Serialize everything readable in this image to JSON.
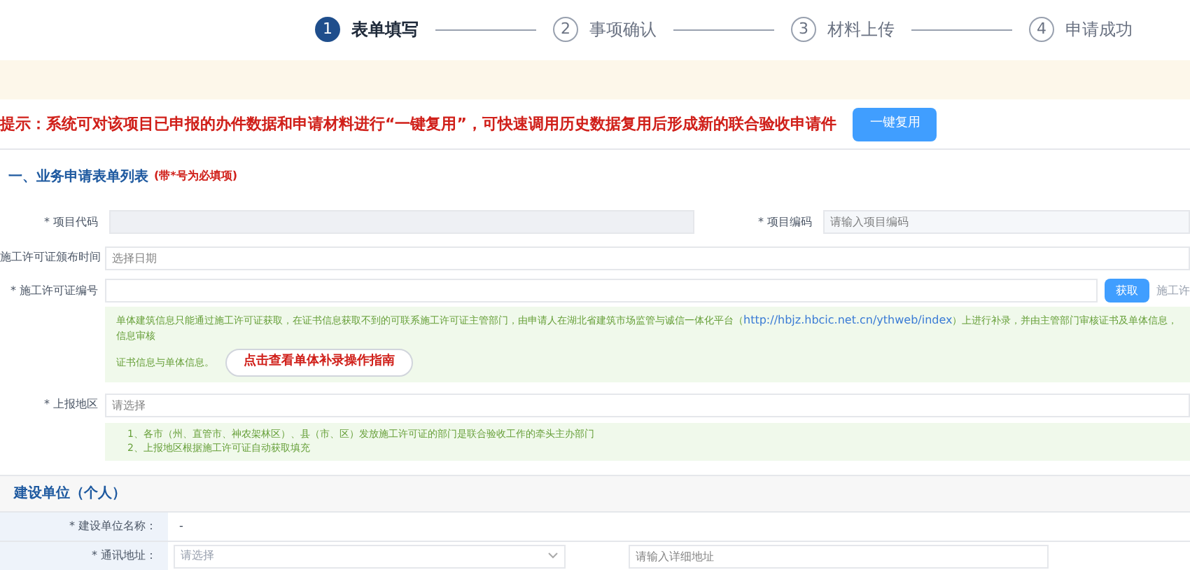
{
  "steps": [
    {
      "number": "1",
      "label": "表单填写",
      "selected": true
    },
    {
      "number": "2",
      "label": "事项确认",
      "selected": false
    },
    {
      "number": "3",
      "label": "材料上传",
      "selected": false
    },
    {
      "number": "4",
      "label": "申请成功",
      "selected": false
    }
  ],
  "tip": {
    "text": "提示：系统可对该项目已申报的办件数据和申请材料进行“一键复用”，可快速调用历史数据复用后形成新的联合验收申请件",
    "button": "一键复用"
  },
  "section1": {
    "title": "一、业务申请表单列表",
    "note": "(带*号为必填项)"
  },
  "form": {
    "project_code": {
      "label": "* 项目代码",
      "disabled": true
    },
    "project_number": {
      "label": "* 项目编码",
      "placeholder": "请输入项目编码"
    },
    "permit_date": {
      "label": "施工许可证颁布时间",
      "placeholder": "选择日期"
    },
    "permit_number": {
      "label": "* 施工许可证编号",
      "button": "获取",
      "extra": "施工许"
    },
    "permit_info": {
      "line1": "单体建筑信息只能通过施工许可证获取，在证书信息获取不到的可联系施工许可证主管部门，由申请人在湖北省建筑市场监管与诚信一体化平台（",
      "link": "http://hbjz.hbcic.net.cn/ythweb/index",
      "line1_end": "）上进行补录，并由主管部门审核证书及单体信息，信息审核",
      "line2": "证书信息与单体信息。",
      "guide_button": "点击查看单体补录操作指南"
    },
    "region": {
      "label": "* 上报地区",
      "placeholder": "请选择",
      "notes": [
        "1、各市（州、直管市、神农架林区）、县（市、区）发放施工许可证的部门是联合验收工作的牵头主办部门",
        "2、上报地区根据施工许可证自动获取填充"
      ]
    }
  },
  "section2": {
    "title": "建设单位（个人）",
    "rows": [
      {
        "kind": "text",
        "label": "* 建设单位名称：",
        "value": "-"
      },
      {
        "kind": "address",
        "label": "* 通讯地址：",
        "placeholder": "请选择",
        "detail_placeholder": "请输入详细地址"
      }
    ]
  }
}
